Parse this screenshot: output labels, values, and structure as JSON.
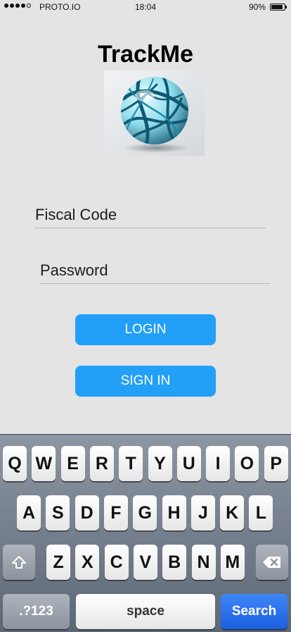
{
  "status_bar": {
    "carrier": "PROTO.IO",
    "time": "18:04",
    "battery": "90%",
    "battery_level": 0.9,
    "signal_bars": 4,
    "signal_max": 5
  },
  "app": {
    "title": "TrackMe",
    "logo_icon": "globe-icon"
  },
  "form": {
    "fiscal_code_label": "Fiscal Code",
    "password_label": "Password",
    "login_label": "LOGIN",
    "signin_label": "SIGN IN"
  },
  "colors": {
    "accent": "#22a0f7",
    "search_key": "#1a5fe0",
    "background": "#e4e4e4"
  },
  "keyboard": {
    "row1": [
      "Q",
      "W",
      "E",
      "R",
      "T",
      "Y",
      "U",
      "I",
      "O",
      "P"
    ],
    "row2": [
      "A",
      "S",
      "D",
      "F",
      "G",
      "H",
      "J",
      "K",
      "L"
    ],
    "row3": [
      "Z",
      "X",
      "C",
      "V",
      "B",
      "N",
      "M"
    ],
    "shift_icon": "shift-icon",
    "delete_icon": "delete-icon",
    "num_label": ".?123",
    "space_label": "space",
    "search_label": "Search"
  }
}
